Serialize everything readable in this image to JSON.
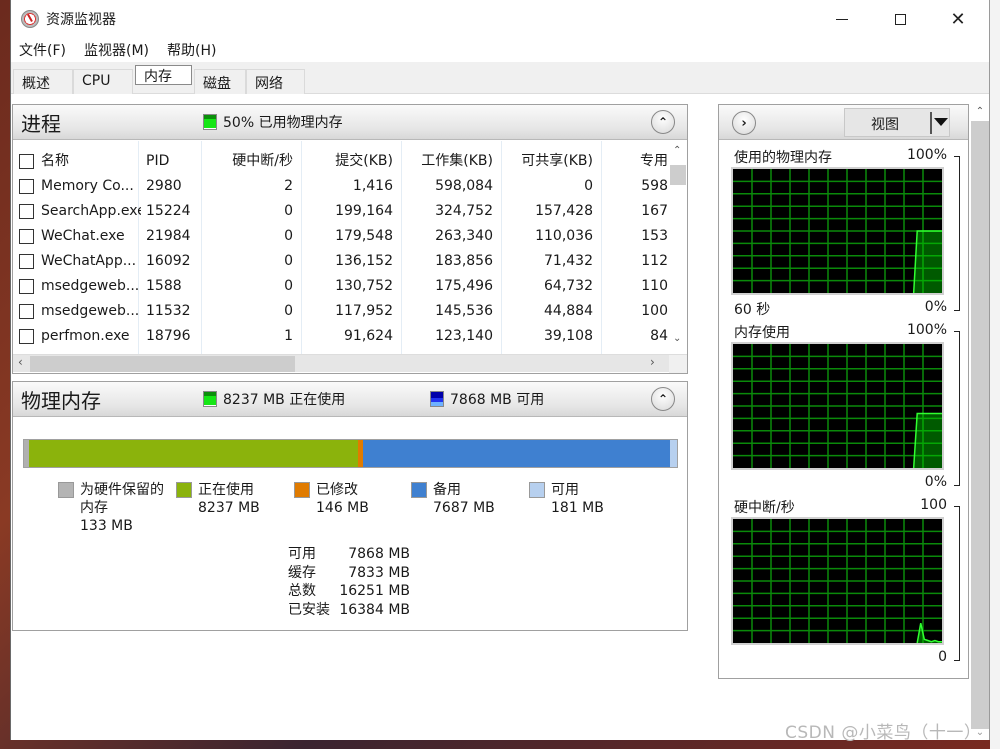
{
  "window": {
    "title": "资源监视器",
    "controls": {
      "minimize": "—",
      "maximize": "□",
      "close": "✕"
    }
  },
  "menu": [
    "文件(F)",
    "监视器(M)",
    "帮助(H)"
  ],
  "tabs": [
    {
      "label": "概述",
      "active": false
    },
    {
      "label": "CPU",
      "active": false
    },
    {
      "label": "内存",
      "active": true
    },
    {
      "label": "磁盘",
      "active": false
    },
    {
      "label": "网络",
      "active": false
    }
  ],
  "processes": {
    "title": "进程",
    "stat": "50% 已用物理内存",
    "columns": [
      "名称",
      "PID",
      "硬中断/秒",
      "提交(KB)",
      "工作集(KB)",
      "可共享(KB)",
      "专用"
    ],
    "rows": [
      [
        "Memory Co...",
        "2980",
        "2",
        "1,416",
        "598,084",
        "0",
        "598"
      ],
      [
        "SearchApp.exe",
        "15224",
        "0",
        "199,164",
        "324,752",
        "157,428",
        "167"
      ],
      [
        "WeChat.exe",
        "21984",
        "0",
        "179,548",
        "263,340",
        "110,036",
        "153"
      ],
      [
        "WeChatApp...",
        "16092",
        "0",
        "136,152",
        "183,856",
        "71,432",
        "112"
      ],
      [
        "msedgeweb...",
        "1588",
        "0",
        "130,752",
        "175,496",
        "64,732",
        "110"
      ],
      [
        "msedgeweb...",
        "11532",
        "0",
        "117,952",
        "145,536",
        "44,884",
        "100"
      ],
      [
        "perfmon.exe",
        "18796",
        "1",
        "91,624",
        "123,140",
        "39,108",
        "84"
      ]
    ]
  },
  "physical_memory": {
    "title": "物理内存",
    "stat_in_use": "8237 MB 正在使用",
    "stat_available": "7868 MB 可用",
    "segments": [
      {
        "name": "hardware_reserved",
        "mb": 133,
        "color": "#b0b0b0"
      },
      {
        "name": "in_use",
        "mb": 8237,
        "color": "#8bb30c"
      },
      {
        "name": "modified",
        "mb": 146,
        "color": "#e07b00"
      },
      {
        "name": "standby",
        "mb": 7687,
        "color": "#3f80d0"
      },
      {
        "name": "free",
        "mb": 181,
        "color": "#b7d0ef"
      }
    ],
    "legend": [
      {
        "label": "为硬件保留的",
        "label2": "内存",
        "value": "133 MB",
        "color": "#b4b4b4"
      },
      {
        "label": "正在使用",
        "value": "8237 MB",
        "color": "#8bb30c"
      },
      {
        "label": "已修改",
        "value": "146 MB",
        "color": "#e07b00"
      },
      {
        "label": "备用",
        "value": "7687 MB",
        "color": "#3f80d0"
      },
      {
        "label": "可用",
        "value": "181 MB",
        "color": "#b7d0ef"
      }
    ],
    "summary": [
      {
        "label": "可用",
        "value": "7868 MB"
      },
      {
        "label": "缓存",
        "value": "7833 MB"
      },
      {
        "label": "总数",
        "value": "16251 MB"
      },
      {
        "label": "已安装",
        "value": "16384 MB"
      }
    ]
  },
  "graphs": {
    "view_label": "视图",
    "items": [
      {
        "title": "使用的物理内存",
        "max": "100%",
        "min": "0%",
        "min_left": "60 秒",
        "series": [
          0,
          0,
          0,
          0,
          0,
          0,
          0,
          0,
          0,
          0,
          0,
          0,
          0,
          0,
          0,
          0,
          0,
          0,
          0,
          0,
          0,
          0,
          0,
          0,
          0,
          0,
          0,
          0,
          0,
          0,
          0,
          0,
          0,
          0,
          0,
          0,
          0,
          0,
          0,
          0,
          0,
          0,
          0,
          0,
          0,
          0,
          0,
          0,
          0,
          0,
          0,
          0,
          50,
          50,
          50,
          50,
          50,
          50,
          50,
          50
        ]
      },
      {
        "title": "内存使用",
        "max": "100%",
        "min": "0%",
        "min_left": "",
        "series": [
          0,
          0,
          0,
          0,
          0,
          0,
          0,
          0,
          0,
          0,
          0,
          0,
          0,
          0,
          0,
          0,
          0,
          0,
          0,
          0,
          0,
          0,
          0,
          0,
          0,
          0,
          0,
          0,
          0,
          0,
          0,
          0,
          0,
          0,
          0,
          0,
          0,
          0,
          0,
          0,
          0,
          0,
          0,
          0,
          0,
          0,
          0,
          0,
          0,
          0,
          0,
          0,
          44,
          44,
          44,
          44,
          44,
          44,
          44,
          44
        ]
      },
      {
        "title": "硬中断/秒",
        "max": "100",
        "min": "0",
        "min_left": "",
        "series": [
          0,
          0,
          0,
          0,
          0,
          0,
          0,
          0,
          0,
          0,
          0,
          0,
          0,
          0,
          0,
          0,
          0,
          0,
          0,
          0,
          0,
          0,
          0,
          0,
          0,
          0,
          0,
          0,
          0,
          0,
          0,
          0,
          0,
          0,
          0,
          0,
          0,
          0,
          0,
          0,
          0,
          0,
          0,
          0,
          0,
          0,
          0,
          0,
          0,
          0,
          0,
          0,
          0,
          16,
          3,
          2,
          1,
          2,
          1,
          1
        ]
      }
    ]
  },
  "watermark": "CSDN @小菜鸟（十一）"
}
